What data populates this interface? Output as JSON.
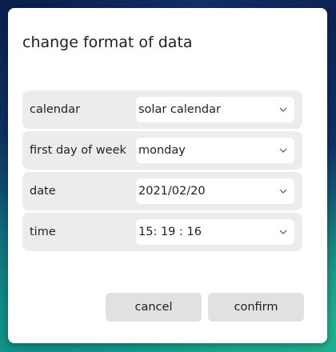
{
  "dialog": {
    "title": "change format of data",
    "rows": [
      {
        "label": "calendar",
        "value": "solar calendar"
      },
      {
        "label": "first day of week",
        "value": "monday"
      },
      {
        "label": "date",
        "value": "2021/02/20"
      },
      {
        "label": "time",
        "value": "15: 19 : 16"
      }
    ],
    "buttons": {
      "cancel": "cancel",
      "confirm": "confirm"
    }
  },
  "icons": {
    "dropdown": "chevron-down-icon"
  },
  "colors": {
    "row_background": "#ececec",
    "button_background": "#e1e1e1",
    "text": "#1f1f1f"
  }
}
